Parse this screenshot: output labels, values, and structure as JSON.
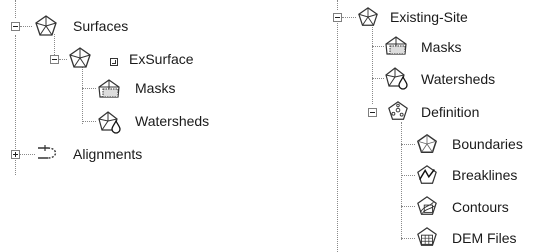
{
  "left_tree": {
    "surfaces_label": "Surfaces",
    "exsurface_label": "ExSurface",
    "masks_label": "Masks",
    "watersheds_label": "Watersheds",
    "alignments_label": "Alignments"
  },
  "right_tree": {
    "existing_site_label": "Existing-Site",
    "masks_label": "Masks",
    "watersheds_label": "Watersheds",
    "definition_label": "Definition",
    "boundaries_label": "Boundaries",
    "breaklines_label": "Breaklines",
    "contours_label": "Contours",
    "dem_files_label": "DEM Files"
  }
}
